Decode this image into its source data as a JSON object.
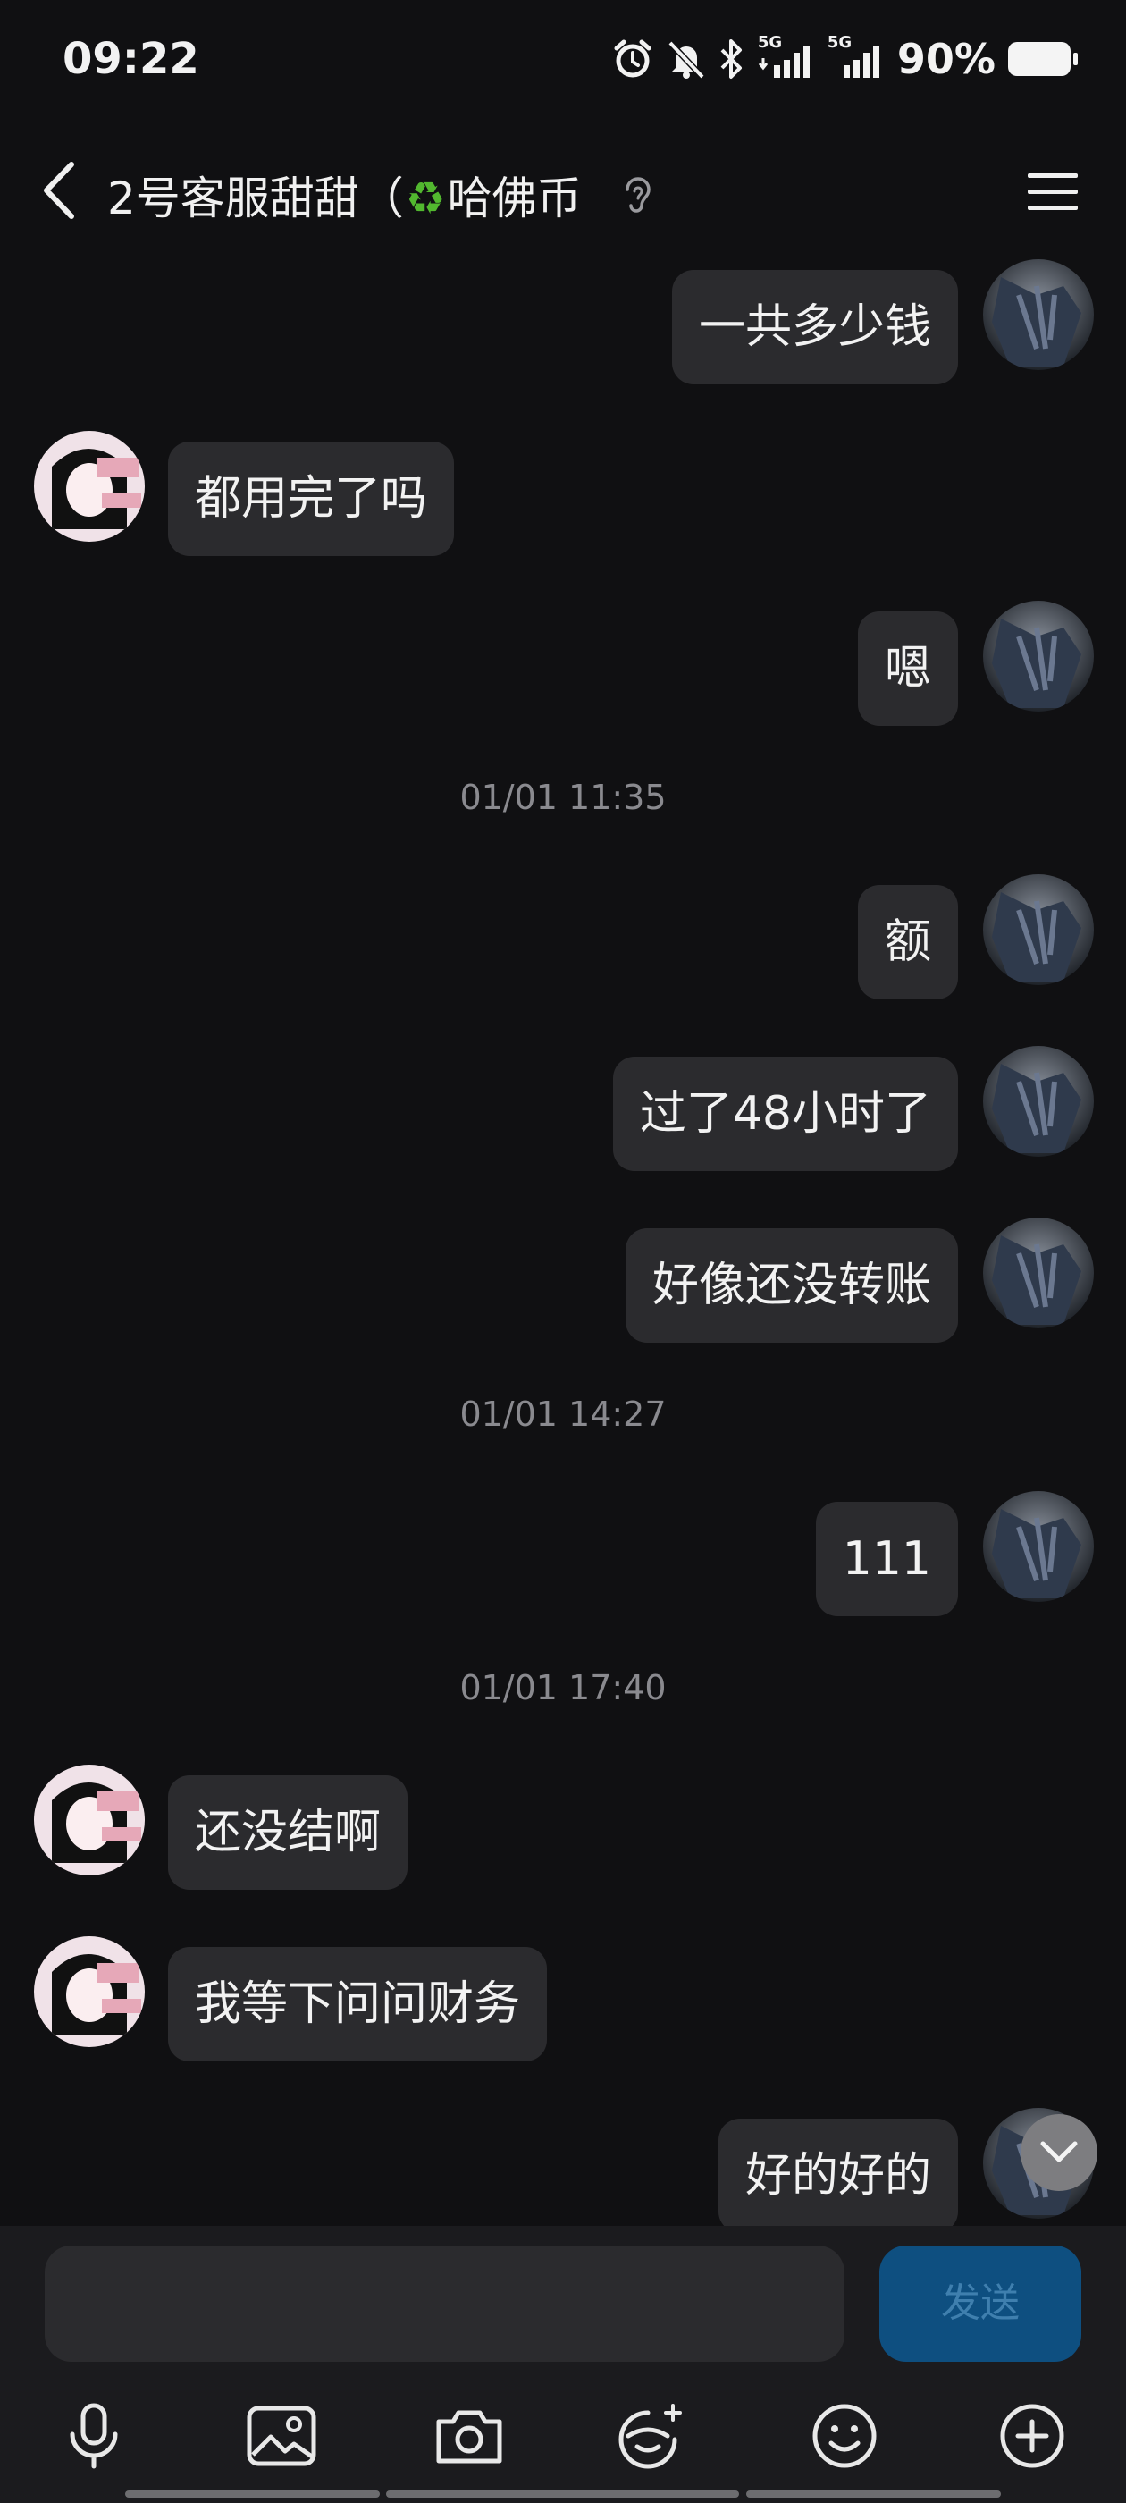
{
  "status_bar": {
    "time": "09:22",
    "net1": "5G",
    "net2": "5G",
    "battery": "90%",
    "icons": [
      "alarm-icon",
      "bell-muted-icon",
      "bluetooth-icon",
      "signal-5g-icon",
      "signal-5g-icon",
      "battery-icon"
    ]
  },
  "header": {
    "title_prefix": "2号客服甜甜（",
    "title_emoji": "♻",
    "title_suffix": "哈佛币",
    "back_icon": "chevron-left-icon",
    "ear_icon": "ear-icon",
    "menu_icon": "menu-icon"
  },
  "messages": [
    {
      "side": "mine",
      "text": "一共多少钱"
    },
    {
      "side": "theirs",
      "text": "都用完了吗"
    },
    {
      "side": "mine",
      "text": "嗯"
    },
    {
      "type": "timestamp",
      "text": "01/01 11:35"
    },
    {
      "side": "mine",
      "text": "额"
    },
    {
      "side": "mine",
      "text": "过了48小时了"
    },
    {
      "side": "mine",
      "text": "好像还没转账"
    },
    {
      "type": "timestamp",
      "text": "01/01 14:27"
    },
    {
      "side": "mine",
      "text": "111"
    },
    {
      "type": "timestamp",
      "text": "01/01 17:40"
    },
    {
      "side": "theirs",
      "text": "还没结啊"
    },
    {
      "side": "theirs",
      "text": "我等下问问财务"
    },
    {
      "side": "mine",
      "text": "好的好的"
    }
  ],
  "composer": {
    "input_value": "",
    "send_label": "发送",
    "tools": [
      "microphone-icon",
      "image-icon",
      "camera-icon",
      "sticker-icon",
      "emoji-icon",
      "plus-icon"
    ]
  },
  "colors": {
    "background": "#101012",
    "bubble": "#2b2b2e",
    "send_button": "#0e4f80",
    "timestamp": "#8a8a8f"
  }
}
